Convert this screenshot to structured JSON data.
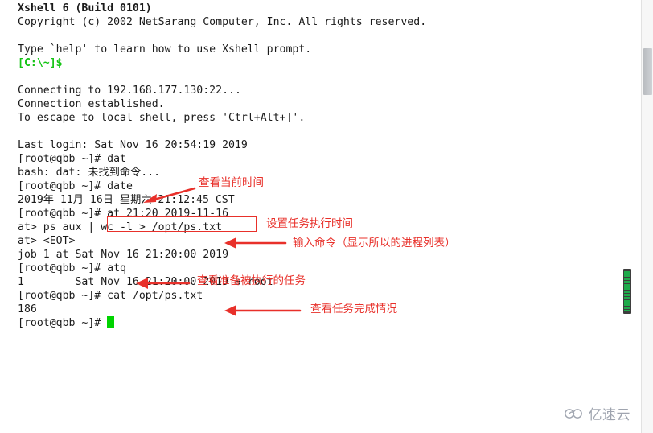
{
  "terminal": {
    "lines": [
      {
        "text": "Xshell 6 (Build 0101)",
        "style": "bold"
      },
      {
        "text": "Copyright (c) 2002 NetSarang Computer, Inc. All rights reserved.",
        "style": "plain"
      },
      {
        "text": "",
        "style": "blank"
      },
      {
        "text": "Type `help' to learn how to use Xshell prompt.",
        "style": "plain"
      },
      {
        "text": "[C:\\~]$",
        "style": "green"
      },
      {
        "text": "",
        "style": "blank"
      },
      {
        "text": "Connecting to 192.168.177.130:22...",
        "style": "plain"
      },
      {
        "text": "Connection established.",
        "style": "plain"
      },
      {
        "text": "To escape to local shell, press 'Ctrl+Alt+]'.",
        "style": "plain"
      },
      {
        "text": "",
        "style": "blank"
      },
      {
        "text": "Last login: Sat Nov 16 20:54:19 2019",
        "style": "plain"
      },
      {
        "text": "[root@qbb ~]# dat",
        "style": "plain"
      },
      {
        "text": "bash: dat: 未找到命令...",
        "style": "plain"
      },
      {
        "text": "[root@qbb ~]# date",
        "style": "plain"
      },
      {
        "text": "2019年 11月 16日 星期六 21:12:45 CST",
        "style": "plain"
      },
      {
        "text": "[root@qbb ~]# at 21:20 2019-11-16",
        "style": "plain"
      },
      {
        "text": "at> ps aux | wc -l > /opt/ps.txt",
        "style": "plain"
      },
      {
        "text": "at> <EOT>",
        "style": "plain"
      },
      {
        "text": "job 1 at Sat Nov 16 21:20:00 2019",
        "style": "plain"
      },
      {
        "text": "[root@qbb ~]# atq",
        "style": "plain"
      },
      {
        "text": "1\t\tSat Nov 16 21:20:00 2019 a root",
        "style": "plain"
      },
      {
        "text": "[root@qbb ~]# cat /opt/ps.txt",
        "style": "plain"
      },
      {
        "text": "186",
        "style": "plain"
      },
      {
        "text": "[root@qbb ~]# ",
        "style": "prompt-cursor"
      }
    ],
    "prompt_line_text": "[root@qbb ~]# ",
    "last_command_line": "1        Sat Nov 16 21:20:00 2019 a root"
  },
  "annotations": [
    {
      "id": "check-current-time",
      "text": "查看当前时间"
    },
    {
      "id": "set-task-exec-time",
      "text": "设置任务执行时间"
    },
    {
      "id": "input-command",
      "text": "输入命令（显示所以的进程列表）"
    },
    {
      "id": "view-pending-tasks",
      "text": "查看准备被执行的任务"
    },
    {
      "id": "view-task-completion",
      "text": "查看任务完成情况"
    }
  ],
  "highlight_box": {
    "label": "at 21:20 2019-11-16",
    "color": "#e8302a"
  },
  "colors": {
    "annotation_red": "#e8302a",
    "prompt_green": "#15c415",
    "cursor_green": "#00d400",
    "terminal_text": "#1b1b1b",
    "terminal_bg": "#ffffff",
    "scrollbar_green": "#1faa4b"
  },
  "watermark": {
    "icon": "cloud-icon",
    "text": "亿速云"
  },
  "scrollbars": {
    "page_scrollbar": "page-vertical-scrollbar",
    "terminal_scrollbar": "terminal-vertical-scrollbar"
  }
}
